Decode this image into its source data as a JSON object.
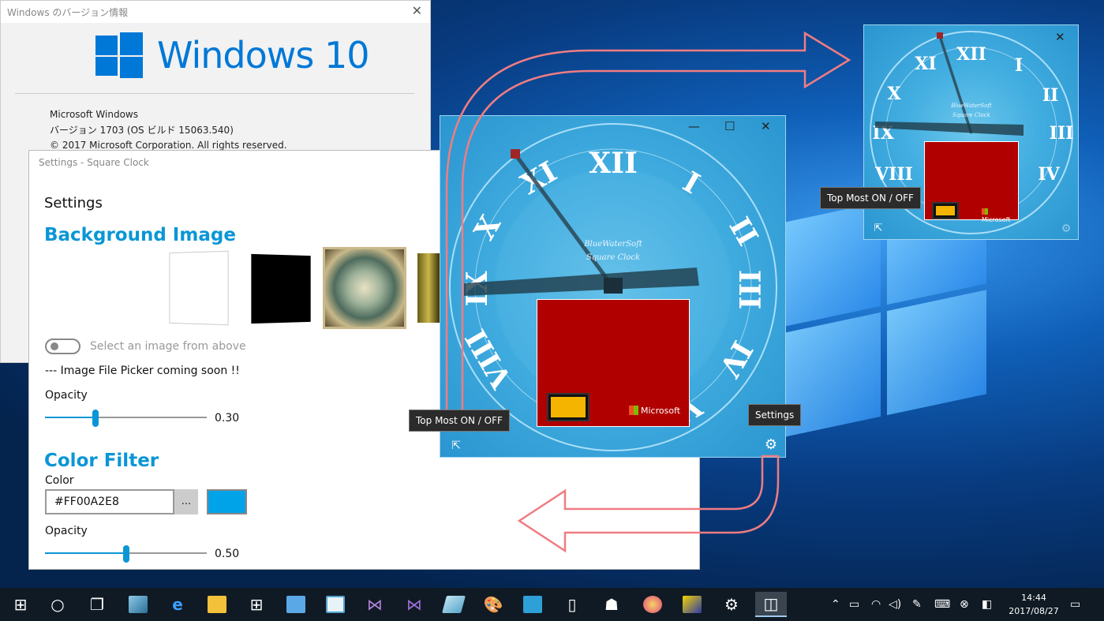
{
  "about_dialog": {
    "title": "Windows のバージョン情報",
    "logo_text": "Windows 10",
    "info_lines": [
      "Microsoft Windows",
      "バージョン 1703 (OS ビルド 15063.540)",
      "© 2017 Microsoft Corporation. All rights reserved."
    ]
  },
  "settings_window": {
    "title": "Settings - Square Clock",
    "heading": "Settings",
    "background_section": "Background Image",
    "toggle_label": "Select an image from above",
    "picker_note": "--- Image File Picker coming soon !!",
    "opacity_label": "Opacity",
    "bg_opacity": "0.30",
    "bg_opacity_fraction": 0.3,
    "color_section": "Color Filter",
    "color_label": "Color",
    "color_value": "#FF00A2E8",
    "color_picker_button": "...",
    "filter_opacity_label": "Opacity",
    "filter_opacity": "0.50",
    "filter_opacity_fraction": 0.5,
    "swatch_color": "#00a2e8"
  },
  "clock_large": {
    "brand_line1": "BlueWaterSoft",
    "brand_line2": "Square Clock",
    "ad_text": "Microsoft",
    "tooltip_topmost": "Top Most ON / OFF",
    "tooltip_settings": "Settings"
  },
  "clock_small": {
    "brand_line1": "BlueWaterSoft",
    "brand_line2": "Square Clock",
    "ad_text": "Microsoft",
    "tooltip_topmost": "Top Most ON / OFF"
  },
  "taskbar": {
    "time": "14:44",
    "date": "2017/08/27",
    "icons": [
      "start-icon",
      "cortana-icon",
      "task-view-icon",
      "photos-icon",
      "edge-icon",
      "file-explorer-icon",
      "store-icon",
      "app-icon",
      "notepad-icon",
      "visual-studio-icon",
      "visual-studio-blend-icon",
      "paint3d-icon",
      "paint-icon",
      "azure-icon",
      "phone-icon",
      "people-icon",
      "palette-icon",
      "game-icon",
      "settings-icon",
      "square-clock-icon"
    ]
  },
  "colors": {
    "accent": "#0a96d6",
    "arrow": "#f07c82",
    "ad_red": "#b00000"
  }
}
